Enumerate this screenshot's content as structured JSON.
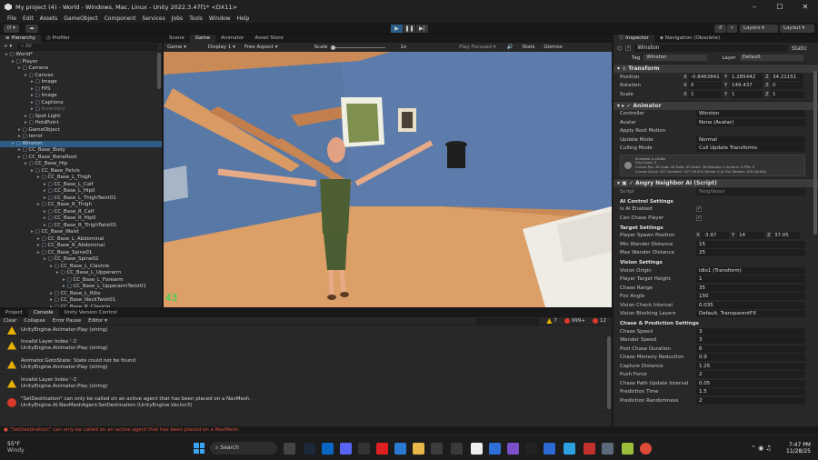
{
  "window": {
    "title": "My project (4) - World - Windows, Mac, Linux - Unity 2022.3.47f1* <DX11>"
  },
  "menu": [
    "File",
    "Edit",
    "Assets",
    "GameObject",
    "Component",
    "Services",
    "Jobs",
    "Tools",
    "Window",
    "Help"
  ],
  "toolbar": {
    "account": "D",
    "layers": "Layers",
    "layout": "Layout"
  },
  "hierarchy": {
    "tab": "Hierarchy",
    "tab2": "Profiler",
    "search_placeholder": "All",
    "items": [
      {
        "label": "World*",
        "depth": 0
      },
      {
        "label": "Player",
        "depth": 1
      },
      {
        "label": "Camera",
        "depth": 2
      },
      {
        "label": "Canvas",
        "depth": 3
      },
      {
        "label": "Image",
        "depth": 4
      },
      {
        "label": "FPS",
        "depth": 4
      },
      {
        "label": "Image",
        "depth": 4
      },
      {
        "label": "Captions",
        "depth": 4
      },
      {
        "label": "Inventory",
        "depth": 4
      },
      {
        "label": "Spot Light",
        "depth": 3
      },
      {
        "label": "HoldPoint",
        "depth": 3
      },
      {
        "label": "GameObject",
        "depth": 2
      },
      {
        "label": "terror",
        "depth": 2
      },
      {
        "label": "Winston",
        "depth": 1,
        "sel": true
      },
      {
        "label": "CC_Base_Body",
        "depth": 2
      },
      {
        "label": "CC_Base_BoneRoot",
        "depth": 2
      },
      {
        "label": "CC_Base_Hip",
        "depth": 3
      },
      {
        "label": "CC_Base_Pelvis",
        "depth": 4
      },
      {
        "label": "CC_Base_L_Thigh",
        "depth": 5
      },
      {
        "label": "CC_Base_L_Calf",
        "depth": 6
      },
      {
        "label": "CC_Base_L_Hip0",
        "depth": 6
      },
      {
        "label": "CC_Base_L_ThighTwist01",
        "depth": 6
      },
      {
        "label": "CC_Base_R_Thigh",
        "depth": 5
      },
      {
        "label": "CC_Base_R_Calf",
        "depth": 6
      },
      {
        "label": "CC_Base_R_Hip0",
        "depth": 6
      },
      {
        "label": "CC_Base_R_ThighTwist01",
        "depth": 6
      },
      {
        "label": "CC_Base_Waist",
        "depth": 4
      },
      {
        "label": "CC_Base_L_Abdominal",
        "depth": 5
      },
      {
        "label": "CC_Base_R_Abdominal",
        "depth": 5
      },
      {
        "label": "CC_Base_Spine01",
        "depth": 5
      },
      {
        "label": "CC_Base_Spine02",
        "depth": 6
      },
      {
        "label": "CC_Base_L_Clavicle",
        "depth": 7
      },
      {
        "label": "CC_Base_L_Upperarm",
        "depth": 8
      },
      {
        "label": "CC_Base_L_Forearm",
        "depth": 9
      },
      {
        "label": "CC_Base_L_UpperarmTwist01",
        "depth": 9
      },
      {
        "label": "CC_Base_L_Ribs",
        "depth": 7
      },
      {
        "label": "CC_Base_NeckTwist01",
        "depth": 7
      },
      {
        "label": "CC_Base_R_Clavicle",
        "depth": 7
      }
    ]
  },
  "scene_tabs": [
    "Scene",
    "Game",
    "Animator",
    "Asset Store"
  ],
  "game_toolbar": {
    "mode": "Game",
    "display": "Display 1",
    "aspect": "Free Aspect",
    "scale_label": "Scale",
    "scale_value": "1x",
    "play_focus": "Play Focused",
    "stats": "Stats",
    "gizmos": "Gizmos"
  },
  "game_view": {
    "fps": "43"
  },
  "console": {
    "tabs": [
      "Project",
      "Console",
      "Unity Version Control"
    ],
    "clear": "Clear",
    "collapse": "Collapse",
    "error_pause": "Error Pause",
    "editor": "Editor",
    "count_warn": "7",
    "count_err_a": "999+",
    "count_err_b": "12",
    "entries": [
      {
        "type": "warn",
        "line1": "UnityEngine.Animator:Play (string)",
        "line2": ""
      },
      {
        "type": "warn",
        "line1": "Invalid Layer Index '-1'",
        "line2": "UnityEngine.Animator:Play (string)"
      },
      {
        "type": "warn",
        "line1": "Animator.GotoState: State could not be found",
        "line2": "UnityEngine.Animator:Play (string)"
      },
      {
        "type": "warn",
        "line1": "Invalid Layer Index '-1'",
        "line2": "UnityEngine.Animator:Play (string)"
      },
      {
        "type": "err",
        "line1": "\"SetDestination\" can only be called on an active agent that has been placed on a NavMesh.",
        "line2": "UnityEngine.AI.NavMeshAgent:SetDestination (UnityEngine.Vector3)"
      }
    ]
  },
  "status": {
    "message": "\"SetDestination\" can only be called on an active agent that has been placed on a NavMesh."
  },
  "inspector": {
    "tab": "Inspector",
    "tab2": "Navigation (Obsolete)",
    "object_name": "Winston",
    "static": "Static",
    "tag_label": "Tag",
    "tag": "Winston",
    "layer_label": "Layer",
    "layer": "Default",
    "transform": {
      "title": "Transform",
      "position": [
        "-0.8463841",
        "1.285442",
        "34.21151"
      ],
      "rotation": [
        "0",
        "149.437",
        "0"
      ],
      "scale": [
        "1",
        "1",
        "1"
      ],
      "labels": [
        "Position",
        "Rotation",
        "Scale"
      ]
    },
    "animator": {
      "title": "Animator",
      "controller_label": "Controller",
      "controller": "Winston",
      "avatar_label": "Avatar",
      "avatar": "None (Avatar)",
      "root_motion": "Apply Root Motion",
      "update_label": "Update Mode",
      "update": "Normal",
      "culling_label": "Culling Mode",
      "culling": "Cull Update Transforms",
      "info": "Animator is visible\nClip Count: 3\nCurves Pos: 38 Quat: 49 Euler: 49 Scale: 26 Muscles: 0 Generic: 0 PPtr: 0\nCurves Count: 247 Constant: 147 (59.4%) Dense: 0 (0.0%) Stream: 100 (40.6%)"
    },
    "script": {
      "title": "Angry Neighbor AI (Script)",
      "script_label": "Script",
      "script": "Neighbour",
      "sections": [
        {
          "title": "AI Control Settings",
          "props": [
            {
              "k": "Is AI Enabled",
              "check": true
            },
            {
              "k": "Can Chase Player",
              "check": true
            }
          ]
        },
        {
          "title": "Target Settings",
          "props": [
            {
              "k": "Player Spawn Position",
              "xyz": [
                "-3.97",
                "14",
                "37.05"
              ]
            },
            {
              "k": "Min Wander Distance",
              "v": "15"
            },
            {
              "k": "Max Wander Distance",
              "v": "25"
            }
          ]
        },
        {
          "title": "Vision Settings",
          "props": [
            {
              "k": "Vision Origin",
              "v": "idlo1 (Transform)"
            },
            {
              "k": "Player Target Height",
              "v": "1"
            },
            {
              "k": "Chase Range",
              "v": "35"
            },
            {
              "k": "Fov Angle",
              "v": "150"
            },
            {
              "k": "Vision Check Interval",
              "v": "0.035"
            },
            {
              "k": "Vision Blocking Layers",
              "v": "Default, TransparentFX"
            }
          ]
        },
        {
          "title": "Chase & Prediction Settings",
          "props": [
            {
              "k": "Chase Speed",
              "v": "3"
            },
            {
              "k": "Wander Speed",
              "v": "3"
            },
            {
              "k": "Post Chase Duration",
              "v": "6"
            },
            {
              "k": "Chase Memory Reduction",
              "v": "0.9"
            },
            {
              "k": "Capture Distance",
              "v": "1.25"
            },
            {
              "k": "Push Force",
              "v": "2"
            },
            {
              "k": "Chase Path Update Interval",
              "v": "0.05"
            },
            {
              "k": "Prediction Time",
              "v": "1.5"
            },
            {
              "k": "Prediction Randomness",
              "v": "2"
            }
          ]
        }
      ]
    }
  },
  "taskbar": {
    "weather_temp": "55°F",
    "weather_desc": "Windy",
    "search": "Search",
    "time": "7:47 PM",
    "date": "11/28/25"
  }
}
